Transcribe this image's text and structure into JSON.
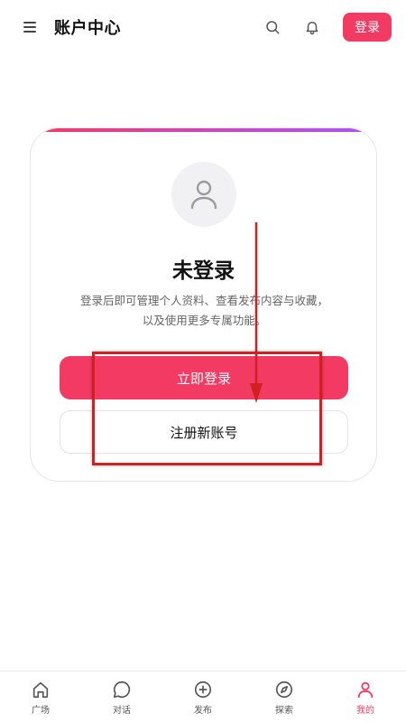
{
  "header": {
    "title": "账户中心",
    "menu_icon": "menu-icon",
    "search_icon": "search-icon",
    "bell_icon": "bell-icon",
    "login_label": "登录"
  },
  "card": {
    "avatar_icon": "user-icon",
    "status": "未登录",
    "description_line1": "登录后即可管理个人资料、查看发布内容与收藏，",
    "description_line2": "以及使用更多专属功能。",
    "login_button": "立即登录",
    "register_button": "注册新账号"
  },
  "nav": {
    "items": [
      {
        "label": "广场",
        "icon": "home-icon",
        "active": false
      },
      {
        "label": "对话",
        "icon": "chat-icon",
        "active": false
      },
      {
        "label": "发布",
        "icon": "plus-circle-icon",
        "active": false
      },
      {
        "label": "探索",
        "icon": "compass-icon",
        "active": false
      },
      {
        "label": "我的",
        "icon": "user-icon",
        "active": true
      }
    ]
  },
  "colors": {
    "accent": "#f23a63",
    "gradient_end": "#a855f7",
    "annotation": "#d21f1f"
  }
}
